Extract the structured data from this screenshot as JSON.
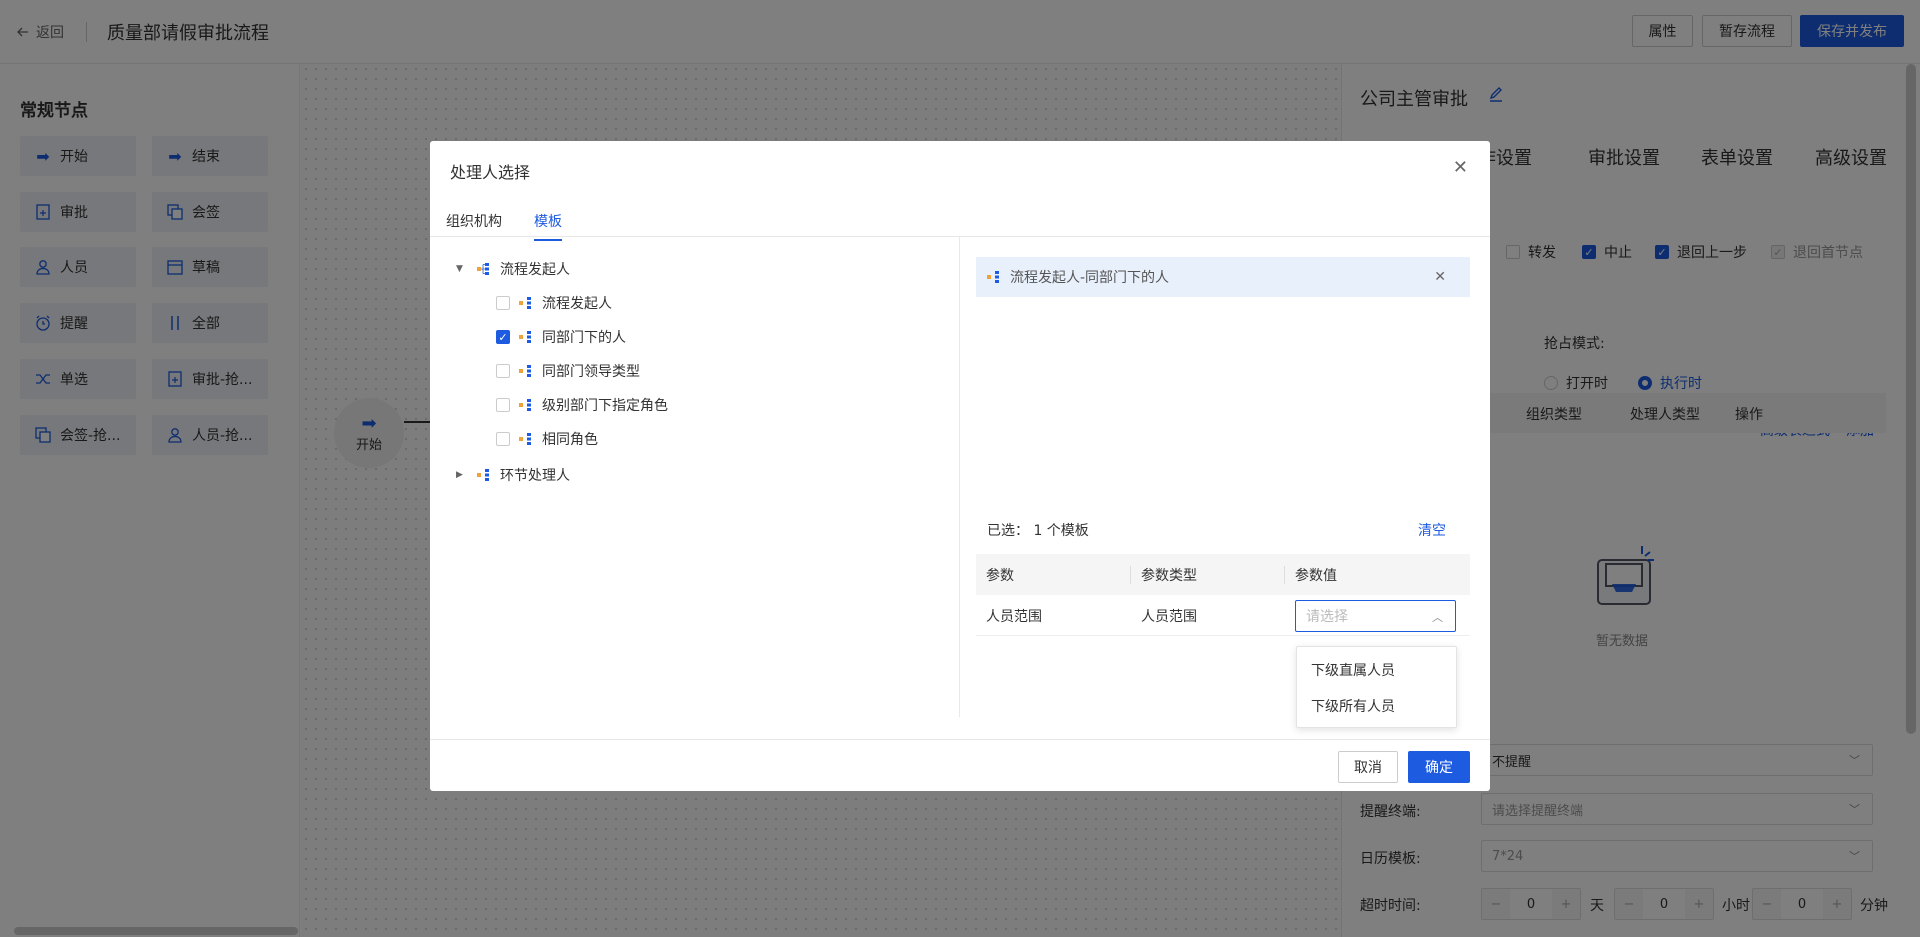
{
  "header": {
    "back_label": "返回",
    "title": "质量部请假审批流程",
    "buttons": {
      "props": "属性",
      "save_draft": "暂存流程",
      "save_publish": "保存并发布"
    }
  },
  "palette": {
    "title": "常规节点",
    "nodes": [
      "开始",
      "结束",
      "审批",
      "会签",
      "人员",
      "草稿",
      "提醒",
      "全部",
      "单选",
      "审批-抢...",
      "会签-抢...",
      "人员-抢..."
    ]
  },
  "canvas": {
    "start_label": "开始"
  },
  "panel": {
    "title": "公司主管审批",
    "tabs": [
      "作设置",
      "审批设置",
      "表单设置",
      "高级设置"
    ],
    "checks": [
      {
        "label": "转发",
        "checked": false,
        "disabled": false
      },
      {
        "label": "中止",
        "checked": true,
        "disabled": false
      },
      {
        "label": "退回上一步",
        "checked": true,
        "disabled": false
      },
      {
        "label": "退回首节点",
        "checked": true,
        "disabled": true
      }
    ],
    "grab_mode_label": "抢占模式:",
    "radios": [
      {
        "label": "打开时",
        "checked": false
      },
      {
        "label": "执行时",
        "checked": true
      }
    ],
    "links": {
      "advanced_expr": "高级表达式",
      "add": "添加"
    },
    "table_headers": [
      "组织类型",
      "处理人类型",
      "操作"
    ],
    "empty_text": "暂无数据",
    "remind_value": "不提醒",
    "remind_terminal_label": "提醒终端:",
    "remind_terminal_placeholder": "请选择提醒终端",
    "calendar_label": "日历模板:",
    "calendar_value": "7*24",
    "timeout_label": "超时时间:",
    "timeout": [
      {
        "value": "0",
        "unit": "天"
      },
      {
        "value": "0",
        "unit": "小时"
      },
      {
        "value": "0",
        "unit": "分钟"
      }
    ]
  },
  "modal": {
    "title": "处理人选择",
    "tabs": [
      {
        "label": "组织机构",
        "active": false
      },
      {
        "label": "模板",
        "active": true
      }
    ],
    "tree": {
      "root1": "流程发起人",
      "children": [
        {
          "label": "流程发起人",
          "checked": false
        },
        {
          "label": "同部门下的人",
          "checked": true
        },
        {
          "label": "同部门领导类型",
          "checked": false
        },
        {
          "label": "级别部门下指定角色",
          "checked": false
        },
        {
          "label": "相同角色",
          "checked": false
        }
      ],
      "root2": "环节处理人"
    },
    "selected_item": "流程发起人-同部门下的人",
    "selected_count": "已选： 1 个模板",
    "clear": "清空",
    "param_headers": [
      "参数",
      "参数类型",
      "参数值"
    ],
    "param_row": {
      "param": "人员范围",
      "type": "人员范围",
      "placeholder": "请选择"
    },
    "dropdown_options": [
      "下级直属人员",
      "下级所有人员"
    ],
    "cancel": "取消",
    "confirm": "确定"
  }
}
